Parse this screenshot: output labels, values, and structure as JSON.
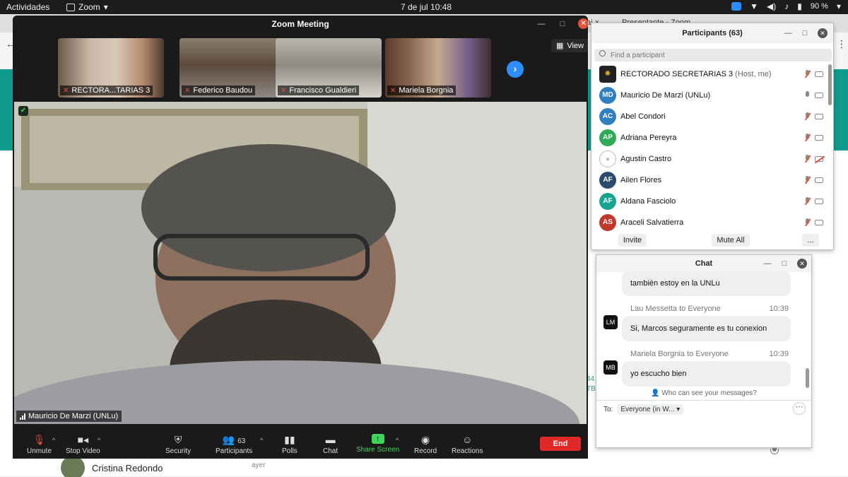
{
  "topbar": {
    "activities": "Actividades",
    "app_name": "Zoom",
    "clock": "7 de jul  10:48",
    "battery": "90 %"
  },
  "background": {
    "tab_label": "Presentante - Zoom",
    "tab_label2": "ai  ×",
    "contact_name": "Cristina Redondo",
    "contact_time": "ayer",
    "side_text_1": "44",
    "side_text_2": "TB"
  },
  "meeting": {
    "title": "Zoom Meeting",
    "view_label": "View",
    "thumbnails": [
      {
        "name": "RECTORA...TARIAS 3"
      },
      {
        "name": "Federico Baudou"
      },
      {
        "name": "Francisco Gualdieri"
      },
      {
        "name": "Mariela Borgnia"
      }
    ],
    "active_speaker": "Mauricio De Marzi (UNLu)",
    "toolbar": {
      "unmute": "Unmute",
      "stop_video": "Stop Video",
      "security": "Security",
      "participants": "Participants",
      "participants_count": "63",
      "polls": "Polls",
      "chat": "Chat",
      "share_screen": "Share Screen",
      "record": "Record",
      "reactions": "Reactions",
      "end": "End"
    }
  },
  "participants": {
    "title": "Participants (63)",
    "search_placeholder": "Find a participant",
    "items": [
      {
        "initials": "",
        "name": "RECTORADO SECRETARIAS 3",
        "tag": " (Host, me)",
        "color": "#222222",
        "mic": "muted",
        "cam": "on"
      },
      {
        "initials": "MD",
        "name": "Mauricio De Marzi (UNLu)",
        "tag": "",
        "color": "#2f7fc1",
        "mic": "on",
        "cam": "on"
      },
      {
        "initials": "AC",
        "name": "Abel Condori",
        "tag": "",
        "color": "#2f7fc1",
        "mic": "muted",
        "cam": "on"
      },
      {
        "initials": "AP",
        "name": "Adriana Pereyra",
        "tag": "",
        "color": "#2eaa57",
        "mic": "muted",
        "cam": "on"
      },
      {
        "initials": "",
        "name": "Agustin Castro",
        "tag": "",
        "color": "#ffffff",
        "mic": "muted",
        "cam": "off"
      },
      {
        "initials": "AF",
        "name": "Ailen Flores",
        "tag": "",
        "color": "#2a4a6e",
        "mic": "muted",
        "cam": "on"
      },
      {
        "initials": "AF",
        "name": "Aldana Fasciolo",
        "tag": "",
        "color": "#17a38e",
        "mic": "muted",
        "cam": "on"
      },
      {
        "initials": "AS",
        "name": "Araceli Salvatierra",
        "tag": "",
        "color": "#c0392b",
        "mic": "muted",
        "cam": "on"
      }
    ],
    "invite": "Invite",
    "mute_all": "Mute All",
    "more": "..."
  },
  "chat": {
    "title": "Chat",
    "messages": [
      {
        "sender": "",
        "time": "",
        "avatar": "",
        "text": "también estoy en la UNLu"
      },
      {
        "sender": "Lau Messetta to Everyone",
        "time": "10:39",
        "avatar": "LM",
        "text": "Si, Marcos seguramente es tu conexion"
      },
      {
        "sender": "Mariela Borgnia to Everyone",
        "time": "10:39",
        "avatar": "MB",
        "text": "yo escucho bien"
      }
    ],
    "who_can_see": "Who can see your messages?",
    "to_label": "To:",
    "to_value": "Everyone (in W...",
    "more": "···"
  }
}
